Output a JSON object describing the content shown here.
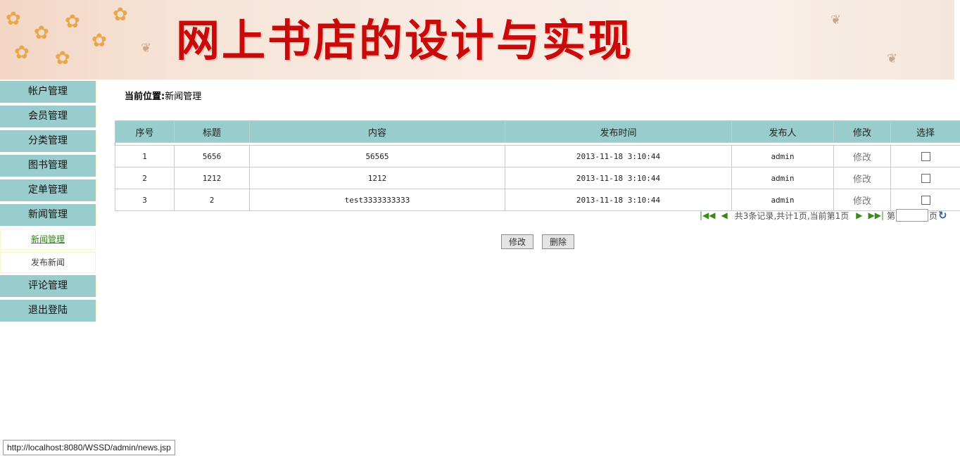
{
  "banner": {
    "title": "网上书店的设计与实现"
  },
  "sidebar": {
    "items": [
      {
        "label": "帐户管理"
      },
      {
        "label": "会员管理"
      },
      {
        "label": "分类管理"
      },
      {
        "label": "图书管理"
      },
      {
        "label": "定单管理"
      },
      {
        "label": "新闻管理"
      }
    ],
    "sub_items": [
      {
        "label": "新闻管理",
        "active": true
      },
      {
        "label": "发布新闻",
        "active": false
      }
    ],
    "items_after": [
      {
        "label": "评论管理"
      },
      {
        "label": "退出登陆"
      }
    ]
  },
  "breadcrumb": {
    "prefix": "当前位置:",
    "current": "新闻管理"
  },
  "table": {
    "headers": [
      "序号",
      "标题",
      "内容",
      "发布时间",
      "发布人",
      "修改",
      "选择"
    ],
    "rows": [
      {
        "index": "1",
        "title": "5656",
        "content": "56565",
        "time": "2013-11-18 3:10:44",
        "author": "admin",
        "edit": "修改"
      },
      {
        "index": "2",
        "title": "1212",
        "content": "1212",
        "time": "2013-11-18 3:10:44",
        "author": "admin",
        "edit": "修改"
      },
      {
        "index": "3",
        "title": "2",
        "content": "test3333333333",
        "time": "2013-11-18 3:10:44",
        "author": "admin",
        "edit": "修改"
      }
    ]
  },
  "pager": {
    "info": "共3条记录,共计1页,当前第1页",
    "page_prefix": "第",
    "page_suffix": "页",
    "page_value": ""
  },
  "buttons": {
    "edit": "修改",
    "delete": "删除"
  },
  "status_bar": {
    "url": "http://localhost:8080/WSSD/admin/news.jsp"
  },
  "colors": {
    "menu_bg": "#99cccc",
    "title_red": "#c80a0a",
    "active_link": "#2f8a18",
    "pager_icon": "#3a8a1a"
  },
  "icons": {
    "first": "first-page-icon",
    "prev": "prev-page-icon",
    "next": "next-page-icon",
    "last": "last-page-icon",
    "go": "go-icon"
  }
}
